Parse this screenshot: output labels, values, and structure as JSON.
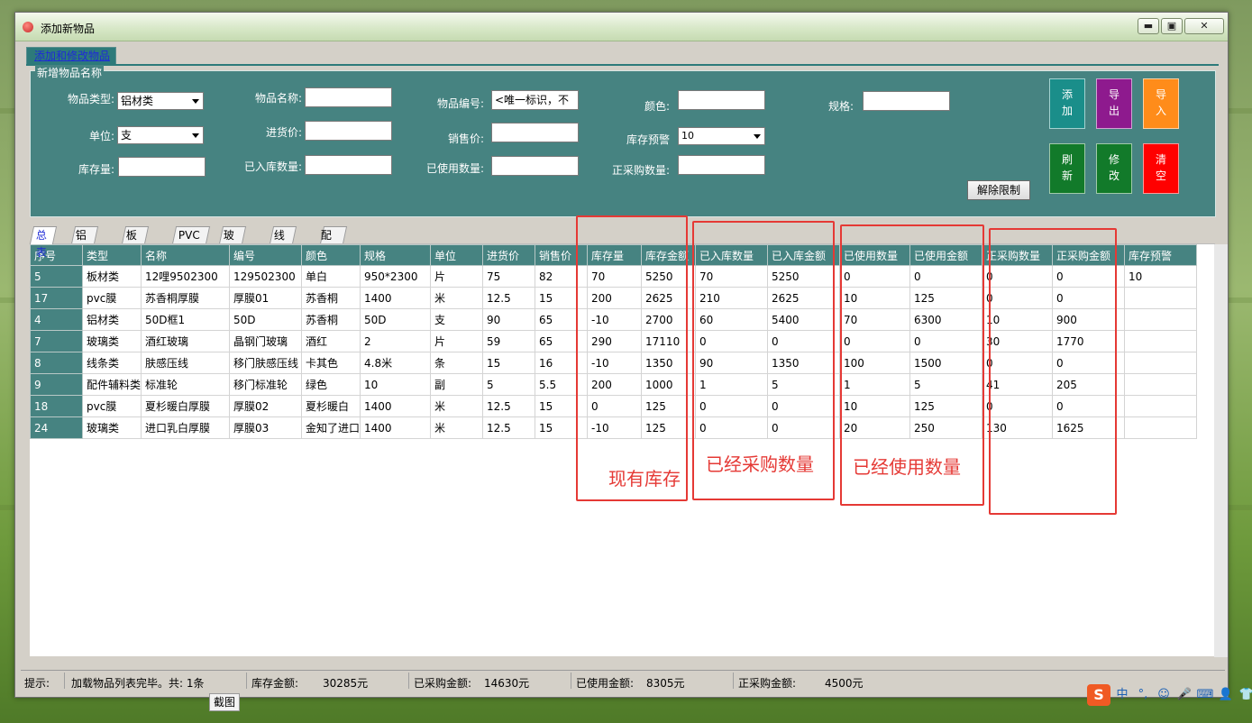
{
  "window": {
    "title": "添加新物品",
    "min_label": "▬",
    "max_label": "▣",
    "close_label": "✕"
  },
  "outer_tab": {
    "label": "添加和修改物品"
  },
  "form": {
    "legend": "新增物品名称",
    "category_label": "物品类型:",
    "category_value": "铝材类",
    "unit_label": "单位:",
    "unit_value": "支",
    "stock_label": "库存量:",
    "stock_value": "",
    "name_label": "物品名称:",
    "name_value": "",
    "purchase_price_label": "进货价:",
    "purchase_price_value": "",
    "stocked_qty_label": "已入库数量:",
    "stocked_qty_value": "",
    "code_label": "物品编号:",
    "code_value": "<唯一标识，不",
    "sale_price_label": "销售价:",
    "sale_price_value": "",
    "used_qty_label": "已使用数量:",
    "used_qty_value": "",
    "color_label": "颜色:",
    "color_value": "",
    "alert_label": "库存预警",
    "alert_value": "10",
    "purchasing_qty_label": "正采购数量:",
    "purchasing_qty_value": "",
    "spec_label": "规格:",
    "spec_value": ""
  },
  "buttons": {
    "add": [
      "添",
      "加"
    ],
    "export": [
      "导",
      "出"
    ],
    "import": [
      "导",
      "入"
    ],
    "refresh": [
      "刷",
      "新"
    ],
    "edit": [
      "修",
      "改"
    ],
    "clear": [
      "清",
      "空"
    ],
    "unlock": "解除限制",
    "colors": {
      "teal": "#1a8e8a",
      "purple": "#8e1a8e",
      "orange": "#ff8c1a",
      "green": "#127a2a",
      "red": "#ff0000"
    }
  },
  "tabs": [
    "总表",
    "铝材类",
    "板材类",
    "PVC膜",
    "玻璃类",
    "线条类",
    "配件辅料类"
  ],
  "grid": {
    "columns": [
      "序号",
      "类型",
      "名称",
      "编号",
      "颜色",
      "规格",
      "单位",
      "进货价",
      "销售价",
      "库存量",
      "库存金额",
      "已入库数量",
      "已入库金额",
      "已使用数量",
      "已使用金额",
      "正采购数量",
      "正采购金额",
      "库存预警"
    ],
    "rows": [
      [
        "5",
        "板材类",
        "12哩9502300",
        "129502300",
        "单白",
        "950*2300",
        "片",
        "75",
        "82",
        "70",
        "5250",
        "70",
        "5250",
        "0",
        "0",
        "0",
        "0",
        "10"
      ],
      [
        "17",
        "pvc膜",
        "苏香桐厚膜",
        "厚膜01",
        "苏香桐",
        "1400",
        "米",
        "12.5",
        "15",
        "200",
        "2625",
        "210",
        "2625",
        "10",
        "125",
        "0",
        "0",
        ""
      ],
      [
        "4",
        "铝材类",
        "50D框1",
        "50D",
        "苏香桐",
        "50D",
        "支",
        "90",
        "65",
        "-10",
        "2700",
        "60",
        "5400",
        "70",
        "6300",
        "10",
        "900",
        ""
      ],
      [
        "7",
        "玻璃类",
        "酒红玻璃",
        "晶钢门玻璃",
        "酒红",
        "2",
        "片",
        "59",
        "65",
        "290",
        "17110",
        "0",
        "0",
        "0",
        "0",
        "30",
        "1770",
        ""
      ],
      [
        "8",
        "线条类",
        "肤感压线",
        "移门肤感压线",
        "卡其色",
        "4.8米",
        "条",
        "15",
        "16",
        "-10",
        "1350",
        "90",
        "1350",
        "100",
        "1500",
        "0",
        "0",
        ""
      ],
      [
        "9",
        "配件辅料类",
        "标准轮",
        "移门标准轮",
        "绿色",
        "10",
        "副",
        "5",
        "5.5",
        "200",
        "1000",
        "1",
        "5",
        "1",
        "5",
        "41",
        "205",
        ""
      ],
      [
        "18",
        "pvc膜",
        "夏杉暖白厚膜",
        "厚膜02",
        "夏杉暖白",
        "1400",
        "米",
        "12.5",
        "15",
        "0",
        "125",
        "0",
        "0",
        "10",
        "125",
        "0",
        "0",
        ""
      ],
      [
        "24",
        "玻璃类",
        "进口乳白厚膜",
        "厚膜03",
        "金知了进口",
        "1400",
        "米",
        "12.5",
        "15",
        "-10",
        "125",
        "0",
        "0",
        "20",
        "250",
        "130",
        "1625",
        ""
      ]
    ]
  },
  "annotations": {
    "stock": "现有库存",
    "purchased": "已经采购数量",
    "used": "已经使用数量",
    "color": "#e53935"
  },
  "status_bar": {
    "hint_label": "提示:",
    "hint_value": "加载物品列表完毕。共: 1条",
    "stock_amount_label": "库存金额:",
    "stock_amount_value": "30285元",
    "purchased_amount_label": "已采购金额:",
    "purchased_amount_value": "14630元",
    "used_amount_label": "已使用金额:",
    "used_amount_value": "8305元",
    "purchasing_amount_label": "正采购金额:",
    "purchasing_amount_value": "4500元"
  },
  "tooltip": "截图",
  "ime": {
    "logo": "S",
    "mode": "中",
    "punct": "°,",
    "emoji": "☺",
    "mic": "🎤",
    "keyboard": "⌨",
    "user": "👤",
    "shirt": "👕"
  }
}
